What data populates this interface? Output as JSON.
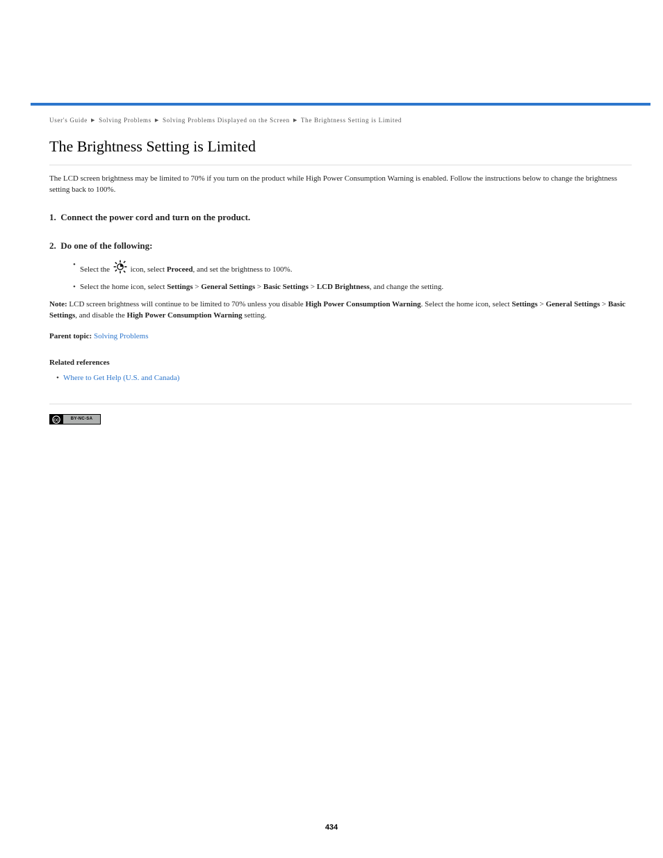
{
  "breadcrumb": [
    "User's Guide",
    "Solving Problems",
    "Solving Problems Displayed on the Screen",
    "The Brightness Setting is Limited"
  ],
  "breadcrumb_sep": "▶",
  "title": "The Brightness Setting is Limited",
  "intro": "The LCD screen brightness may be limited to 70% if you turn on the product while High Power Consumption Warning is enabled. Follow the instructions below to change the brightness setting back to 100%.",
  "steps": {
    "s1": "Connect the power cord and turn on the product.",
    "s2": "Do one of the following:"
  },
  "bullets": {
    "b1_a": "Select the ",
    "b1_b": " icon, select ",
    "b1_c": "Proceed",
    "b1_d": ", and set the brightness to 100%.",
    "b2_a": "Select the home icon, select ",
    "b2_b": "Settings",
    "b2_c": " > ",
    "b2_d": "General Settings",
    "b2_e": " > ",
    "b2_f": "Basic Settings",
    "b2_g": " > ",
    "b2_h": "LCD Brightness",
    "b2_i": ", and change the setting."
  },
  "note_label": "Note:",
  "note_text_a": "LCD screen brightness will continue to be limited to 70% unless you disable ",
  "note_text_b": "High Power Consumption Warning",
  "note_text_c": ". Select the home icon, select ",
  "note_text_d": "Settings",
  "note_text_e": " > ",
  "note_text_f": "General Settings",
  "note_text_g": " > ",
  "note_text_h": "Basic Settings",
  "note_text_i": ", and disable the ",
  "note_text_j": "High Power Consumption Warning",
  "note_text_k": " setting.",
  "parent_heading": "Parent topic:",
  "parent_link": "Solving Problems",
  "related_heading": "Related references",
  "related_link": "Where to Get Help (U.S. and Canada)",
  "cc_text": "BY-NC-SA",
  "page_number": "434"
}
